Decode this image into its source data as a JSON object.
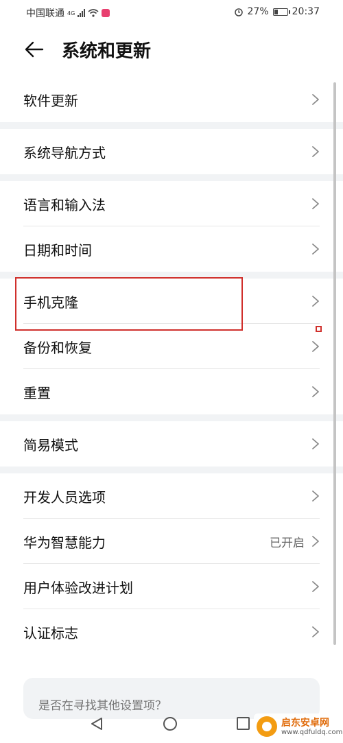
{
  "status": {
    "carrier": "中国联通",
    "network": "4G",
    "battery": "27%",
    "battery_level": 0.27,
    "time": "20:37"
  },
  "header": {
    "title": "系统和更新",
    "back_icon": "back-arrow-icon"
  },
  "groups": [
    {
      "items": [
        {
          "label": "软件更新",
          "value": ""
        }
      ]
    },
    {
      "items": [
        {
          "label": "系统导航方式",
          "value": ""
        }
      ]
    },
    {
      "items": [
        {
          "label": "语言和输入法",
          "value": ""
        },
        {
          "label": "日期和时间",
          "value": ""
        }
      ]
    },
    {
      "items": [
        {
          "label": "手机克隆",
          "value": ""
        },
        {
          "label": "备份和恢复",
          "value": ""
        },
        {
          "label": "重置",
          "value": ""
        }
      ]
    },
    {
      "items": [
        {
          "label": "简易模式",
          "value": ""
        }
      ]
    },
    {
      "items": [
        {
          "label": "开发人员选项",
          "value": ""
        },
        {
          "label": "华为智慧能力",
          "value": "已开启"
        },
        {
          "label": "用户体验改进计划",
          "value": ""
        },
        {
          "label": "认证标志",
          "value": ""
        }
      ]
    }
  ],
  "suggestion": {
    "text": "是否在寻找其他设置项？"
  },
  "watermark": {
    "title": "启东安卓网",
    "url": "www.qdfuldq.com"
  },
  "colors": {
    "highlight": "#d0302c",
    "background_gap": "#f1f3f5"
  }
}
